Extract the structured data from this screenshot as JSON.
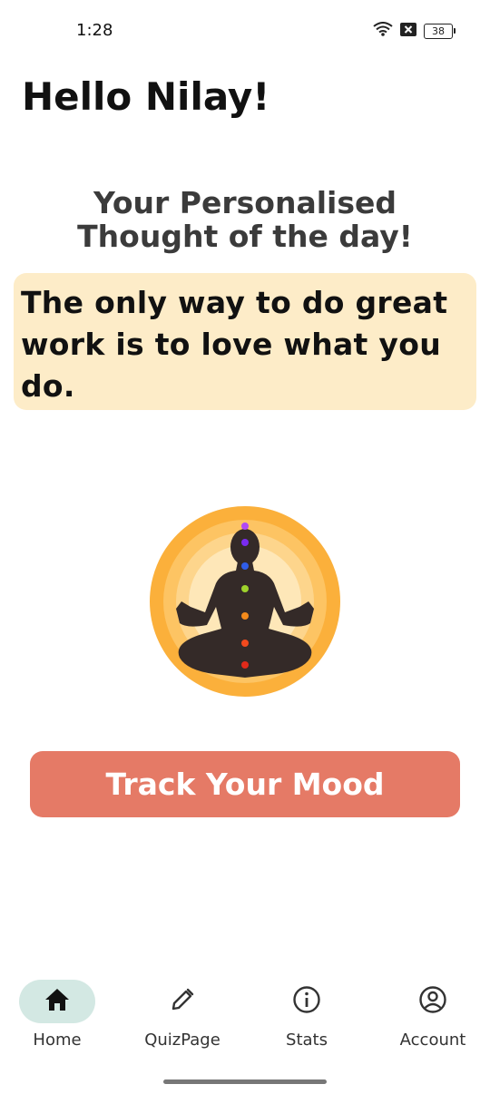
{
  "status_bar": {
    "time": "1:28",
    "battery_level": "38",
    "icons": [
      "wifi-icon",
      "notification-x-icon",
      "battery-icon"
    ]
  },
  "greeting": "Hello Nilay!",
  "thought": {
    "title_line1": "Your Personalised",
    "title_line2": "Thought of the day!",
    "quote": "The only way to do great work is to love what you do."
  },
  "illustration": {
    "icon": "meditation-chakra-icon"
  },
  "mood_button": {
    "label": "Track Your Mood",
    "color": "#e57a66"
  },
  "bottom_nav": {
    "items": [
      {
        "label": "Home",
        "icon": "home-icon",
        "active": true
      },
      {
        "label": "QuizPage",
        "icon": "pencil-icon",
        "active": false
      },
      {
        "label": "Stats",
        "icon": "info-icon",
        "active": false
      },
      {
        "label": "Account",
        "icon": "account-circle-icon",
        "active": false
      }
    ],
    "active_color": "#d3e8e3"
  },
  "colors": {
    "quote_card": "#fdecc8",
    "background": "#ffffff"
  }
}
